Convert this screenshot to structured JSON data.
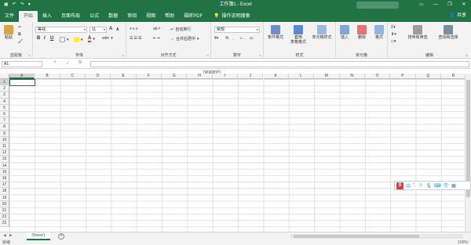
{
  "titlebar": {
    "title": "工作簿1 - Excel",
    "qat": [
      "save-icon",
      "undo-icon",
      "redo-icon",
      "customize-icon"
    ],
    "window_controls": [
      "minimize",
      "restore",
      "close"
    ],
    "bg": "#217346"
  },
  "tabs": [
    "文件",
    "开始",
    "插入",
    "页面布局",
    "公式",
    "数据",
    "审阅",
    "视图",
    "帮助",
    "福昕PDF"
  ],
  "active_tab": "开始",
  "tellme": "操作说明搜索",
  "share": "共享",
  "ribbon": {
    "clipboard": {
      "label": "剪贴板",
      "paste": "粘贴"
    },
    "font": {
      "label": "字体",
      "name": "等线",
      "size": "11",
      "bold": "B",
      "italic": "I",
      "underline": "U",
      "grow": "A",
      "shrink": "A",
      "color_a": "A",
      "wen": "wén"
    },
    "alignment": {
      "label": "对齐方式",
      "wrap": "自动换行",
      "merge": "合并后居中"
    },
    "number": {
      "label": "数字",
      "format": "常规"
    },
    "styles": {
      "label": "样式",
      "cond": "条件格式",
      "table": "套用\n表格格式",
      "cell": "单元格样式"
    },
    "cells": {
      "label": "单元格",
      "insert": "插入",
      "delete": "删除",
      "format": "格式"
    },
    "editing": {
      "label": "编辑",
      "sort": "排序和筛选",
      "find": "查找和选择"
    }
  },
  "formula_bar": {
    "name_box": "A1",
    "fx": "fx",
    "cancel": "×",
    "enter": "✓",
    "value": ""
  },
  "grid": {
    "columns": [
      "A",
      "B",
      "C",
      "D",
      "E",
      "F",
      "G",
      "H",
      "I",
      "J",
      "K",
      "L",
      "M",
      "N",
      "O",
      "P",
      "Q",
      "R"
    ],
    "rows": [
      "1",
      "2",
      "3",
      "4",
      "5",
      "6",
      "7",
      "8",
      "9",
      "10",
      "11",
      "12",
      "13",
      "14",
      "15",
      "16",
      "17",
      "18",
      "19",
      "20",
      "21",
      "22",
      "23"
    ],
    "selected": "A1",
    "tooltip": "智能提示"
  },
  "ime": {
    "logo": "S",
    "mode": "中"
  },
  "sheets": [
    "Sheet1"
  ],
  "status": {
    "left": "就绪",
    "zoom": "100%"
  }
}
